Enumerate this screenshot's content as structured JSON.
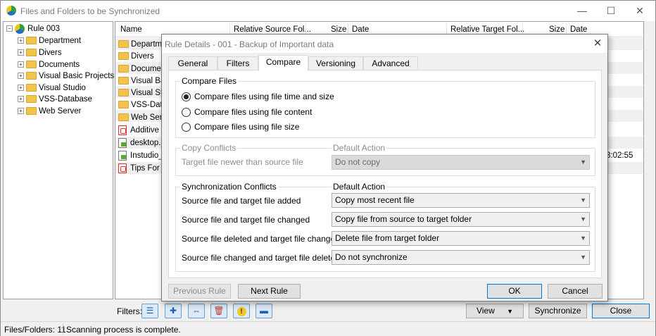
{
  "window": {
    "title": "Files and Folders to be Synchronized",
    "controls": {
      "minimize": "—",
      "maximize": "☐",
      "close": "✕"
    }
  },
  "tree": {
    "root": "Rule 003",
    "items": [
      "Department",
      "Divers",
      "Documents",
      "Visual Basic Projects",
      "Visual Studio",
      "VSS-Database",
      "Web Server"
    ]
  },
  "list": {
    "columns": [
      "Name",
      "Relative Source Fol...",
      "Size",
      "Date",
      "Relative Target Fol...",
      "Size",
      "Date"
    ],
    "rows": [
      {
        "name": "Departme",
        "icon": "folder-icon"
      },
      {
        "name": "Divers",
        "icon": "folder-icon"
      },
      {
        "name": "Documen",
        "icon": "folder-icon"
      },
      {
        "name": "Visual Bas",
        "icon": "folder-icon"
      },
      {
        "name": "Visual Stu",
        "icon": "folder-icon"
      },
      {
        "name": "VSS-Data",
        "icon": "folder-icon"
      },
      {
        "name": "Web Serv",
        "icon": "folder-icon"
      },
      {
        "name": "Additive to",
        "icon": "pdf-icon"
      },
      {
        "name": "desktop.in",
        "icon": "ini-icon"
      },
      {
        "name": "Instudio_jc",
        "icon": "ini-icon"
      },
      {
        "name": "Tips For D",
        "icon": "pdf-icon"
      }
    ],
    "visible_time_fragment": "3:02:55"
  },
  "bottom": {
    "filters_label": "Filters:",
    "filter_icons": [
      "checklist-icon",
      "add-filter-icon",
      "swap-icon",
      "delete-icon",
      "warning-icon",
      "minus-icon"
    ],
    "view_label": "View",
    "synchronize_label": "Synchronize",
    "close_label": "Close"
  },
  "status": {
    "count": "Files/Folders: 11",
    "message": "Scanning process is complete."
  },
  "dialog": {
    "title": "Rule Details - 001 - Backup of Important data",
    "close": "✕",
    "tabs": [
      "General",
      "Filters",
      "Compare",
      "Versioning",
      "Advanced"
    ],
    "active_tab": "Compare",
    "compare_files": {
      "title": "Compare Files",
      "options": [
        {
          "label": "Compare files using file time and size",
          "checked": true
        },
        {
          "label": "Compare files using file content",
          "checked": false
        },
        {
          "label": "Compare files using file size",
          "checked": false
        }
      ]
    },
    "copy_conflicts": {
      "title": "Copy Conflicts",
      "default_action_label": "Default Action",
      "row_label": "Target file newer than source file",
      "value": "Do not copy"
    },
    "sync_conflicts": {
      "title": "Synchronization Conflicts",
      "default_action_label": "Default Action",
      "rows": [
        {
          "label": "Source file and target file added",
          "value": "Copy most recent file"
        },
        {
          "label": "Source file and target file changed",
          "value": "Copy file from source to target folder"
        },
        {
          "label": "Source file deleted and target file changed",
          "value": "Delete file from target folder"
        },
        {
          "label": "Source file changed and target file deleted",
          "value": "Do not synchronize"
        }
      ]
    },
    "buttons": {
      "previous": "Previous Rule",
      "next": "Next Rule",
      "ok": "OK",
      "cancel": "Cancel"
    }
  }
}
